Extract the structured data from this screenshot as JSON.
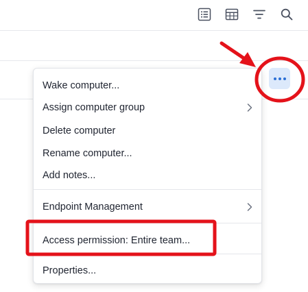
{
  "toolbar": {
    "icons": [
      "list-view-icon",
      "table-view-icon",
      "filter-icon",
      "search-icon"
    ]
  },
  "more_button": {
    "icon": "more-horizontal-icon",
    "accent": "#2b6fd6",
    "background": "#dce9fb"
  },
  "menu": {
    "items": [
      {
        "label": "Wake computer..."
      },
      {
        "label": "Assign computer group",
        "submenu": true
      },
      {
        "label": "Delete computer"
      },
      {
        "label": "Rename computer..."
      },
      {
        "label": "Add notes..."
      },
      {
        "label": "Endpoint Management",
        "submenu": true
      },
      {
        "label": "Access permission: Entire team..."
      },
      {
        "label": "Properties..."
      }
    ]
  },
  "annotations": {
    "color": "#e4121a",
    "highlighted_item": "Access permission: Entire team...",
    "circled_element": "more_button"
  }
}
